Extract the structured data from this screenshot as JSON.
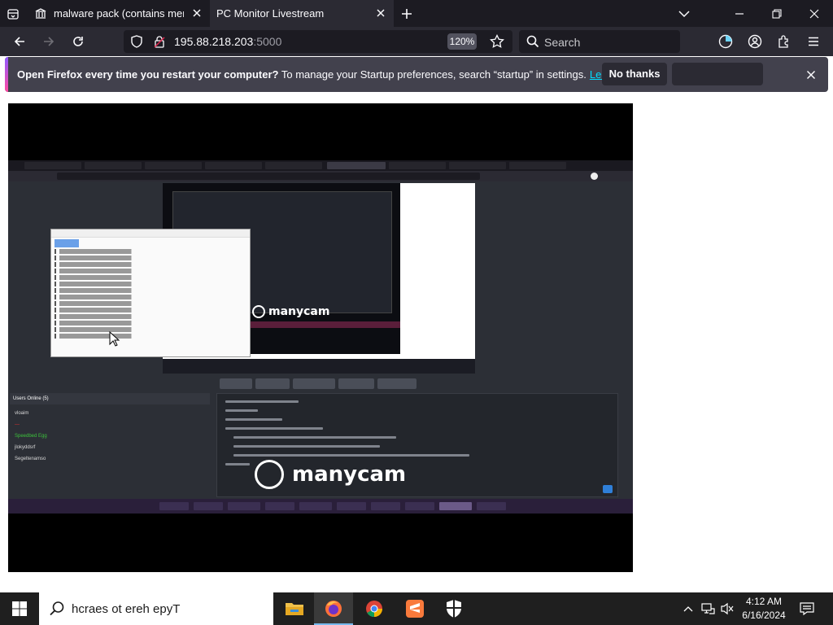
{
  "browser": {
    "tabs": [
      {
        "title": "malware pack (contains memz)",
        "favicon": "library-icon",
        "active": false
      },
      {
        "title": "PC Monitor Livestream",
        "favicon": "",
        "active": true
      }
    ],
    "url_host": "195.88.218.203",
    "url_port": ":5000",
    "zoom": "120%",
    "search_placeholder": "Search"
  },
  "notification": {
    "bold_text": "Open Firefox every time you restart your computer?",
    "text": " To manage your Startup preferences, search “startup” in settings.",
    "link": "Learn more",
    "primary_button": "No thanks"
  },
  "stream": {
    "watermark": "manycam",
    "users_header": "Users Online (5)",
    "users": [
      {
        "name": "vloaim",
        "color": "#d8d8d8"
      },
      {
        "name": "—",
        "color": "#e0302e"
      },
      {
        "name": "Speedbed Egg",
        "color": "#3cc23c"
      },
      {
        "name": "jlokyddsrf",
        "color": "#d8d8d8"
      },
      {
        "name": "Segeltenamso",
        "color": "#d8d8d8"
      }
    ]
  },
  "taskbar": {
    "search_text": "hcraes ot ereh epyT",
    "apps": [
      "file-explorer-icon",
      "firefox-icon",
      "chrome-icon",
      "sublime-icon",
      "shield-icon"
    ],
    "time": "4:12 AM",
    "date": "6/16/2024"
  }
}
